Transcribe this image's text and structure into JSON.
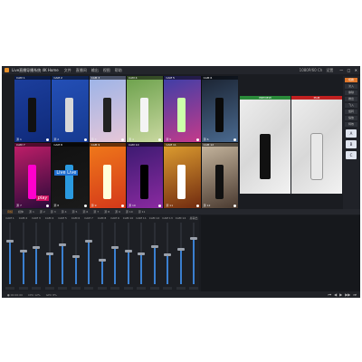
{
  "app": {
    "title": "Live直播导播系统 4K Home"
  },
  "menu": [
    "文件",
    "直播间",
    "输出",
    "视图",
    "帮助"
  ],
  "titlebar": {
    "right": [
      "1080P/60 Ch",
      "设置"
    ],
    "win": [
      "—",
      "□",
      "✕"
    ]
  },
  "sources": [
    {
      "label": "CAM 1",
      "caption": "源 1",
      "colors": [
        "#1c3f9e",
        "#0f2a7a"
      ],
      "figure": "#111"
    },
    {
      "label": "CAM 2",
      "caption": "源 2",
      "colors": [
        "#2450b8",
        "#163a90"
      ],
      "figure": "#d8d8d8"
    },
    {
      "label": "CAM 3",
      "caption": "源 3",
      "colors": [
        "#9ab3e8",
        "#e7c7d8"
      ],
      "figure": "#222"
    },
    {
      "label": "CAM 4",
      "caption": "源 4",
      "colors": [
        "#6aa04a",
        "#c9d8a0"
      ],
      "figure": "#f4f4f4"
    },
    {
      "label": "CAM 5",
      "caption": "源 5",
      "colors": [
        "#3a3fa8",
        "#c43a8a"
      ],
      "figure": "#cfa"
    },
    {
      "label": "CAM 6",
      "caption": "源 6",
      "colors": [
        "#1a2230",
        "#4a6a90"
      ],
      "figure": "#0a0a0a"
    },
    {
      "label": "CAM 7",
      "caption": "源 7",
      "colors": [
        "#c41e6a",
        "#2a0a3a"
      ],
      "figure": "#f0c"
    },
    {
      "label": "CAM 8",
      "caption": "源 8",
      "colors": [
        "#111",
        "#1a1a1a"
      ],
      "figure": "#2a9ae0"
    },
    {
      "label": "CAM 9",
      "caption": "源 9",
      "colors": [
        "#f07a1a",
        "#d4381a"
      ],
      "figure": "#ffd"
    },
    {
      "label": "CAM 10",
      "caption": "源 10",
      "colors": [
        "#3a1a70",
        "#8a2aa0"
      ],
      "figure": "#000"
    },
    {
      "label": "CAM 11",
      "caption": "源 11",
      "colors": [
        "#e0a030",
        "#702a10"
      ],
      "figure": "#fff"
    },
    {
      "label": "CAM 12",
      "caption": "源 12",
      "colors": [
        "#c8b8a0",
        "#4a3a30"
      ],
      "figure": "#111"
    }
  ],
  "overlay_text": {
    "live": "Live Live",
    "play": "play"
  },
  "preview": {
    "label": "PREVIEW",
    "color": "#2a8a3a"
  },
  "program": {
    "label": "PGM",
    "color": "#c02020"
  },
  "right_panel": {
    "buttons": [
      "切换",
      "淡入",
      "擦除",
      "推出",
      "飞入",
      "旋转",
      "缩放",
      "特效"
    ],
    "squares": [
      "A",
      "B",
      "C"
    ]
  },
  "tabs": [
    "音频",
    "媒体",
    "源 1",
    "源 2",
    "源 3",
    "源 4",
    "源 5",
    "源 6",
    "源 7",
    "源 8",
    "源 9",
    "源 10",
    "源 11"
  ],
  "mixer": {
    "channels": [
      "CAM 1",
      "CAM 2",
      "CAM 3",
      "CAM 4",
      "CAM 5",
      "CAM 6",
      "CAM 7",
      "CAM 8",
      "CAM 9",
      "CAM 10",
      "CAM 11",
      "CAM 12",
      "CAM 13",
      "CAM 14",
      "总输出"
    ],
    "levels": [
      0.7,
      0.55,
      0.6,
      0.5,
      0.65,
      0.45,
      0.7,
      0.4,
      0.6,
      0.55,
      0.5,
      0.62,
      0.48,
      0.58,
      0.75
    ]
  },
  "status": [
    "● 00:00:00",
    "CPU 12%",
    "GPU 8%"
  ],
  "controls": [
    "⏮",
    "◀",
    "▶",
    "▶▶",
    "⏭"
  ]
}
